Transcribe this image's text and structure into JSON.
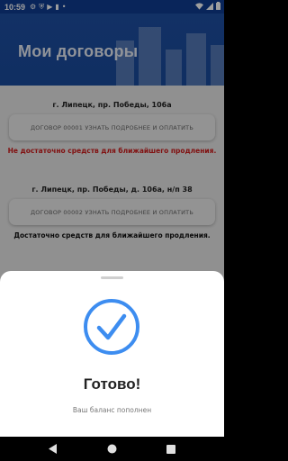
{
  "status_bar": {
    "time": "10:59",
    "notification_icons": [
      "gear-icon",
      "shield-icon",
      "play-protect-icon",
      "sim-icon",
      "dot-icon"
    ],
    "system_icons": [
      "wifi-icon",
      "signal-icon",
      "battery-icon"
    ]
  },
  "header": {
    "title": "Мои договоры"
  },
  "contracts": [
    {
      "address": "г. Липецк, пр. Победы, 106а",
      "button_label": "ДОГОВОР 00001 УЗНАТЬ ПОДРОБНЕЕ И ОПЛАТИТЬ",
      "message": "Не достаточно средств для ближайшего продления.",
      "message_color": "#d11a1a"
    },
    {
      "address": "г. Липецк, пр. Победы, д. 106а, н/п 38",
      "button_label": "ДОГОВОР 00002 УЗНАТЬ ПОДРОБНЕЕ И ОПЛАТИТЬ",
      "message": "Достаточно средств для ближайшего продления.",
      "message_color": "#111111"
    }
  ],
  "sheet": {
    "title": "Готово!",
    "subtitle": "Ваш баланс пополнен",
    "accent_color": "#3d8df0"
  },
  "navbar": {
    "icons": [
      "back-icon",
      "home-icon",
      "recents-icon"
    ]
  }
}
